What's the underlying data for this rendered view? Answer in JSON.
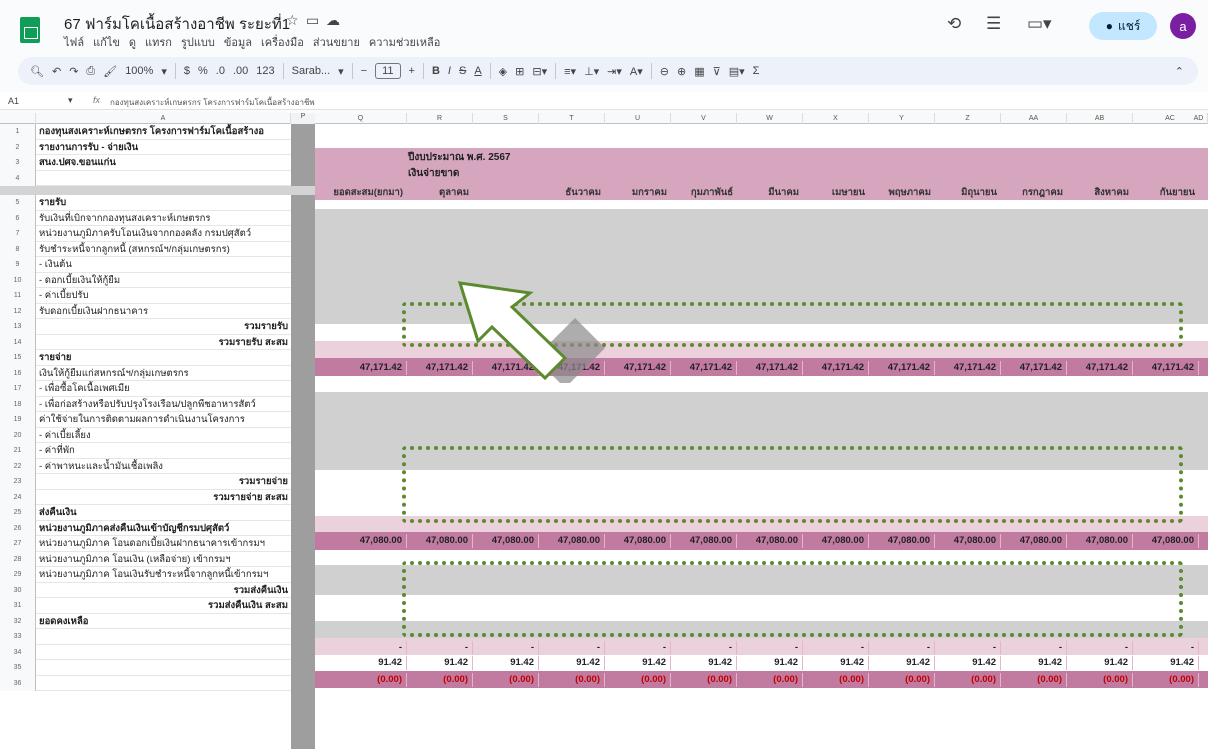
{
  "app": {
    "title": "67 ฟาร์มโคเนื้อสร้างอาชีพ ระยะที่1",
    "menus": [
      "ไฟล์",
      "แก้ไข",
      "ดู",
      "แทรก",
      "รูปแบบ",
      "ข้อมูล",
      "เครื่องมือ",
      "ส่วนขยาย",
      "ความช่วยเหลือ"
    ],
    "share_label": "แชร์",
    "avatar_letter": "a"
  },
  "toolbar": {
    "zoom": "100%",
    "currency": "$",
    "percent": "%",
    "dec_decrease": ".0",
    "dec_increase": ".00",
    "format_123": "123",
    "font": "Sarab...",
    "font_size": "11"
  },
  "formula_bar": {
    "cell_ref": "A1",
    "fx": "fx",
    "content": "กองทุนสงเคราะห์เกษตรกร โครงการฟาร์มโคเนื้อสร้างอาชีพ"
  },
  "columns": [
    "A",
    "P",
    "Q",
    "R",
    "S",
    "T",
    "U",
    "V",
    "W",
    "X",
    "Y",
    "Z",
    "AA",
    "AB",
    "AC",
    "AD"
  ],
  "rows": [
    {
      "n": "1",
      "text": "กองทุนสงเคราะห์เกษตรกร โครงการฟาร์มโคเนื้อสร้างอ",
      "style": "bold"
    },
    {
      "n": "2",
      "text": "รายงานการรับ - จ่ายเงิน",
      "style": "bold"
    },
    {
      "n": "3",
      "text": "สนง.ปศจ.ขอนแก่น",
      "style": "bold"
    },
    {
      "n": "4",
      "text": "",
      "style": ""
    },
    {
      "n": "5",
      "text": "รายรับ",
      "style": "bold"
    },
    {
      "n": "6",
      "text": "รับเงินที่เบิกจากกองทุนสงเคราะห์เกษตรกร",
      "style": ""
    },
    {
      "n": "7",
      "text": "หน่วยงานภูมิภาครับโอนเงินจากกองคลัง กรมปศุสัตว์",
      "style": ""
    },
    {
      "n": "8",
      "text": "รับชำระหนี้จากลูกหนี้ (สหกรณ์ฯ/กลุ่มเกษตรกร)",
      "style": ""
    },
    {
      "n": "9",
      "text": " - เงินต้น",
      "style": ""
    },
    {
      "n": "10",
      "text": " - ดอกเบี้ยเงินให้กู้ยืม",
      "style": ""
    },
    {
      "n": "11",
      "text": " - ค่าเบี้ยปรับ",
      "style": ""
    },
    {
      "n": "12",
      "text": "รับดอกเบี้ยเงินฝากธนาคาร",
      "style": ""
    },
    {
      "n": "13",
      "text": "รวมรายรับ",
      "style": "bold right"
    },
    {
      "n": "14",
      "text": "รวมรายรับ สะสม",
      "style": "bold right"
    },
    {
      "n": "15",
      "text": "รายจ่าย",
      "style": "bold"
    },
    {
      "n": "16",
      "text": "เงินให้กู้ยืมแก่สหกรณ์ฯ/กลุ่มเกษตรกร",
      "style": ""
    },
    {
      "n": "17",
      "text": " - เพื่อซื้อโคเนื้อเพศเมีย",
      "style": ""
    },
    {
      "n": "18",
      "text": " - เพื่อก่อสร้างหรือปรับปรุงโรงเรือน/ปลูกพืชอาหารสัตว์",
      "style": ""
    },
    {
      "n": "19",
      "text": "ค่าใช้จ่ายในการติดตามผลการดำเนินงานโครงการ",
      "style": ""
    },
    {
      "n": "20",
      "text": " - ค่าเบี้ยเลี้ยง",
      "style": ""
    },
    {
      "n": "21",
      "text": " - ค่าที่พัก",
      "style": ""
    },
    {
      "n": "22",
      "text": " - ค่าพาหนะและน้ำมันเชื้อเพลิง",
      "style": ""
    },
    {
      "n": "23",
      "text": "รวมรายจ่าย",
      "style": "bold right"
    },
    {
      "n": "24",
      "text": "รวมรายจ่าย สะสม",
      "style": "bold right"
    },
    {
      "n": "25",
      "text": "ส่งคืนเงิน",
      "style": "bold"
    },
    {
      "n": "26",
      "text": "หน่วยงานภูมิภาคส่งคืนเงินเข้าบัญชีกรมปศุสัตว์",
      "style": "bold"
    },
    {
      "n": "27",
      "text": "หน่วยงานภูมิภาค โอนดอกเบี้ยเงินฝากธนาคารเข้ากรมฯ",
      "style": ""
    },
    {
      "n": "28",
      "text": "หน่วยงานภูมิภาค โอนเงิน (เหลือจ่าย) เข้ากรมฯ",
      "style": ""
    },
    {
      "n": "29",
      "text": "หน่วยงานภูมิภาค โอนเงินรับชำระหนี้จากลูกหนี้เข้ากรมฯ",
      "style": ""
    },
    {
      "n": "30",
      "text": "รวมส่งคืนเงิน",
      "style": "bold right"
    },
    {
      "n": "31",
      "text": "รวมส่งคืนเงิน สะสม",
      "style": "bold right"
    },
    {
      "n": "32",
      "text": "ยอดคงเหลือ",
      "style": "bold"
    },
    {
      "n": "33",
      "text": "",
      "style": ""
    },
    {
      "n": "34",
      "text": "",
      "style": ""
    },
    {
      "n": "35",
      "text": "",
      "style": ""
    },
    {
      "n": "36",
      "text": "",
      "style": ""
    }
  ],
  "header_block": {
    "fiscal_year": "ปีงบประมาณ พ.ศ. 2567",
    "cash_basis": "เงินจ่ายขาด",
    "months": [
      "ยอดสะสม(ยกมา)",
      "ตุลาคม",
      "",
      "ธันวาคม",
      "มกราคม",
      "กุมภาพันธ์",
      "มีนาคม",
      "เมษายน",
      "พฤษภาคม",
      "มิถุนายน",
      "กรกฎาคม",
      "สิงหาคม",
      "กันยายน",
      "รวมทั้"
    ]
  },
  "totals": {
    "income_cum": [
      "47,171.42",
      "47,171.42",
      "47,171.42",
      "47,171.42",
      "47,171.42",
      "47,171.42",
      "47,171.42",
      "47,171.42",
      "47,171.42",
      "47,171.42",
      "47,171.42",
      "47,171.42",
      "47,171.42",
      "47,17"
    ],
    "expense_cum": [
      "47,080.00",
      "47,080.00",
      "47,080.00",
      "47,080.00",
      "47,080.00",
      "47,080.00",
      "47,080.00",
      "47,080.00",
      "47,080.00",
      "47,080.00",
      "47,080.00",
      "47,080.00",
      "47,080.00",
      "47,08"
    ],
    "refund": [
      "-",
      "-",
      "-",
      "-",
      "-",
      "-",
      "-",
      "-",
      "-",
      "-",
      "-",
      "-",
      "-",
      ""
    ],
    "refund_cum": [
      "91.42",
      "91.42",
      "91.42",
      "91.42",
      "91.42",
      "91.42",
      "91.42",
      "91.42",
      "91.42",
      "91.42",
      "91.42",
      "91.42",
      "91.42",
      "9"
    ],
    "balance": [
      "(0.00)",
      "(0.00)",
      "(0.00)",
      "(0.00)",
      "(0.00)",
      "(0.00)",
      "(0.00)",
      "(0.00)",
      "(0.00)",
      "(0.00)",
      "(0.00)",
      "(0.00)",
      "(0.00)",
      "(("
    ]
  },
  "colors": {
    "header_band": "#d5a6bd",
    "total_band": "#ead1dc",
    "cum_band": "#c27ba0",
    "gray_band": "#d0d0d0",
    "dots": "#5c8a2e",
    "negative": "#c00000"
  }
}
